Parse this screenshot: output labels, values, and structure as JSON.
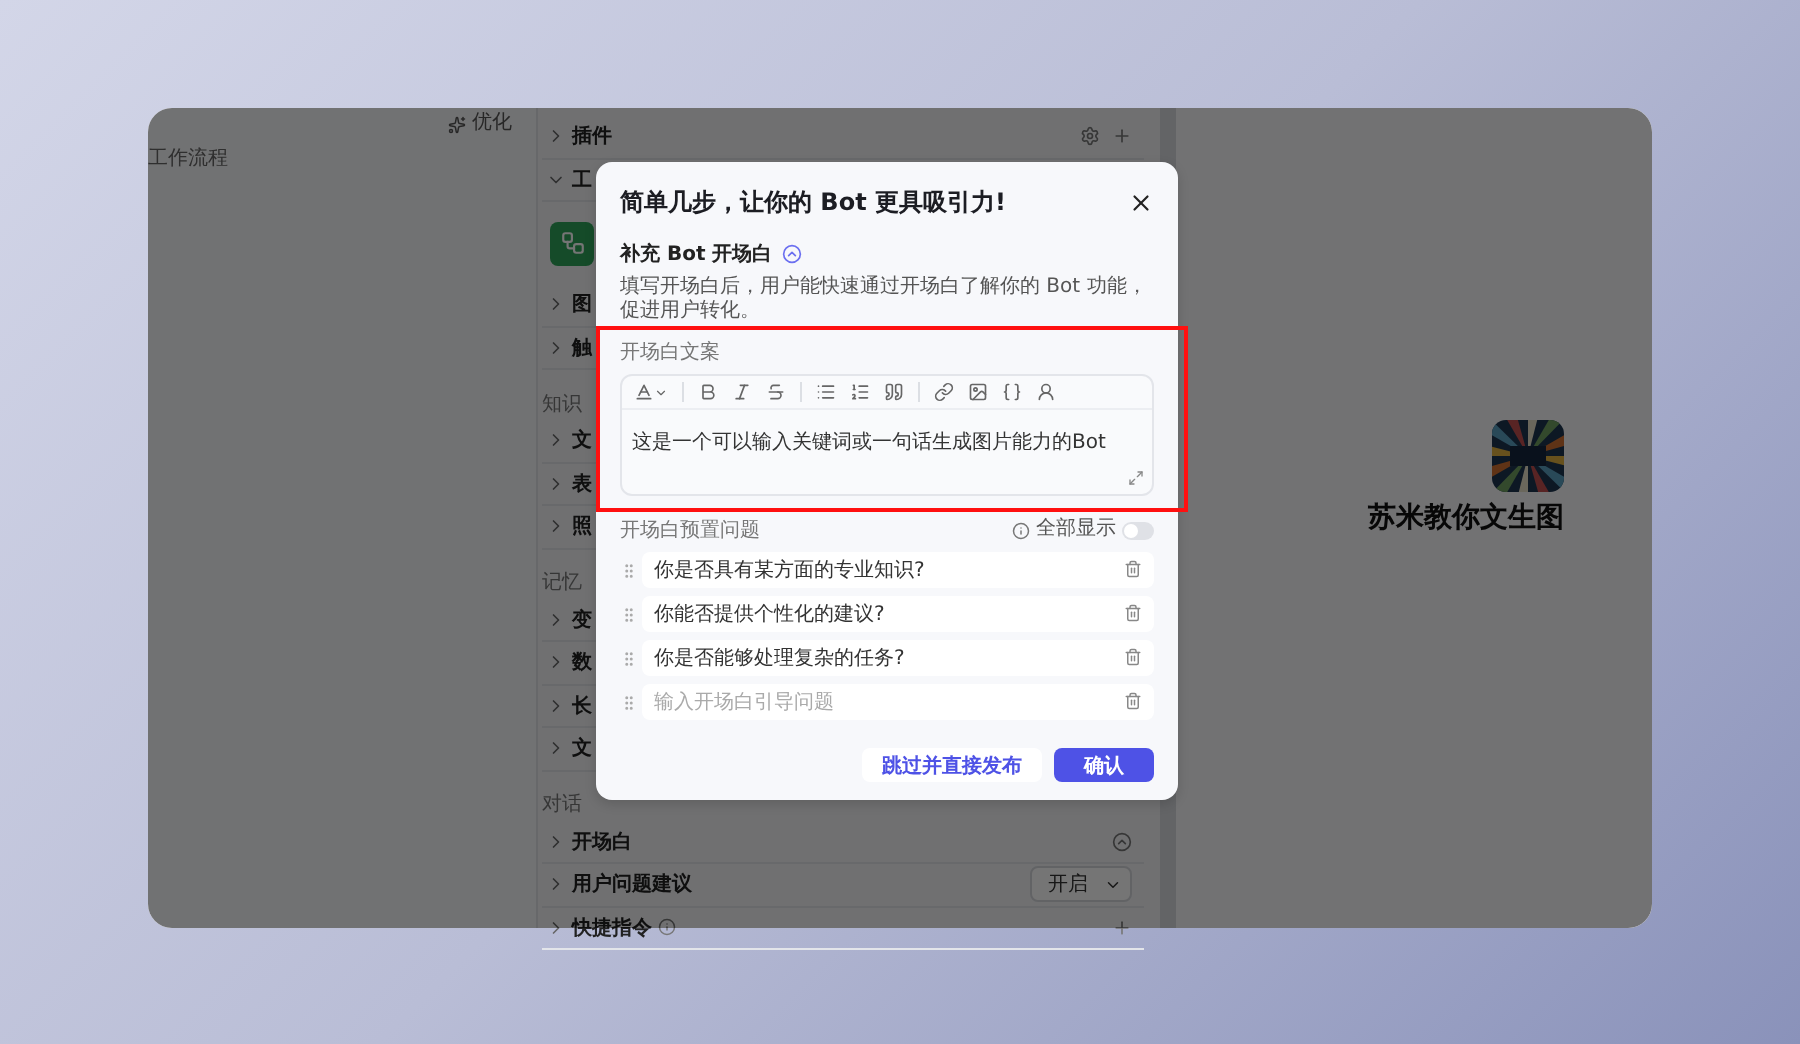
{
  "left_panel": {
    "workflow_label": "工作流程",
    "optimize": "优化"
  },
  "middle_panel": {
    "items": [
      {
        "kind": "tools_item",
        "text": "插件",
        "expanded": false
      },
      {
        "kind": "item",
        "text": "工",
        "expanded": true
      },
      {
        "kind": "card"
      },
      {
        "kind": "item",
        "text": "图",
        "expanded": false
      },
      {
        "kind": "item",
        "text": "触",
        "expanded": false
      },
      {
        "kind": "section",
        "text": "知识"
      },
      {
        "kind": "item",
        "text": "文",
        "expanded": false
      },
      {
        "kind": "item",
        "text": "表",
        "expanded": false
      },
      {
        "kind": "item",
        "text": "照",
        "expanded": false
      },
      {
        "kind": "section",
        "text": "记忆"
      },
      {
        "kind": "item",
        "text": "变",
        "expanded": false
      },
      {
        "kind": "item",
        "text": "数",
        "expanded": false
      },
      {
        "kind": "item",
        "text": "长",
        "expanded": false
      },
      {
        "kind": "item",
        "text": "文",
        "expanded": false
      },
      {
        "kind": "section",
        "text": "对话"
      },
      {
        "kind": "collapse_item",
        "text": "开场白",
        "expanded": false
      },
      {
        "kind": "select_item",
        "text": "用户问题建议",
        "value": "开启",
        "expanded": false
      },
      {
        "kind": "command_item",
        "text": "快捷指令",
        "expanded": false
      }
    ]
  },
  "preview": {
    "bot_name": "苏米教你文生图"
  },
  "modal": {
    "title": "简单几步，让你的 Bot 更具吸引力!",
    "section_title": "补充 Bot 开场白",
    "description": "填写开场白后，用户能快速通过开场白了解你的 Bot 功能，促进用户转化。",
    "editor_label": "开场白文案",
    "editor_value": "这是一个可以输入关键词或一句话生成图片能力的Bot",
    "questions_label": "开场白预置问题",
    "show_all": {
      "label": "全部显示",
      "on": false
    },
    "questions": [
      {
        "value": "你是否具有某方面的专业知识?"
      },
      {
        "value": "你能否提供个性化的建议?"
      },
      {
        "value": "你是否能够处理复杂的任务?"
      },
      {
        "placeholder": "输入开场白引导问题"
      }
    ],
    "buttons": [
      {
        "kind": "secondary",
        "label": "跳过并直接发布"
      },
      {
        "kind": "primary",
        "label": "确认"
      }
    ]
  }
}
